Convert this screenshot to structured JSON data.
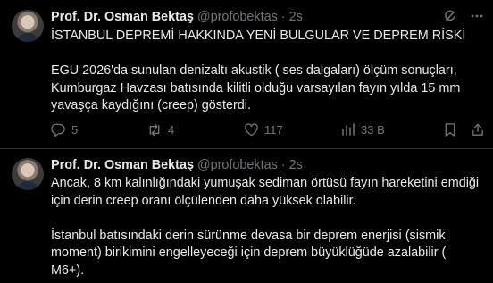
{
  "tweets": [
    {
      "author_name": "Prof. Dr. Osman Bektaş",
      "handle": "@profobektas",
      "separator": "·",
      "time": "2s",
      "paragraphs": [
        "İSTANBUL DEPREMİ HAKKINDA YENİ BULGULAR VE DEPREM RİSKİ",
        "EGU 2026'da sunulan denizaltı akustik ( ses dalgaları) ölçüm sonuçları, Kumburgaz Havzası batısında kilitli olduğu varsayılan fayın yılda 15 mm yavaşça kaydığını (creep) gösterdi."
      ],
      "actions": {
        "replies": "5",
        "reposts": "4",
        "likes": "117",
        "views": "33 B"
      }
    },
    {
      "author_name": "Prof. Dr. Osman Bektaş",
      "handle": "@profobektas",
      "separator": "·",
      "time": "2s",
      "paragraphs": [
        "Ancak, 8 km  kalınlığındaki yumuşak sediman örtüsü fayın hareketini emdiği için derin creep oranı ölçülenden daha yüksek olabilir.",
        "İstanbul batısındaki derin sürünme devasa bir deprem enerjisi (sismik moment) birikimini engelleyeceği için  deprem büyüklüğüde  azalabilir ( M6+)."
      ]
    }
  ],
  "icons": [
    "grok-icon",
    "more-icon",
    "reply-icon",
    "repost-icon",
    "like-icon",
    "views-icon",
    "bookmark-icon",
    "share-icon"
  ],
  "colors": {
    "background": "#000000",
    "text": "#e7e9ea",
    "secondary": "#71767b",
    "divider": "#2f3336"
  }
}
